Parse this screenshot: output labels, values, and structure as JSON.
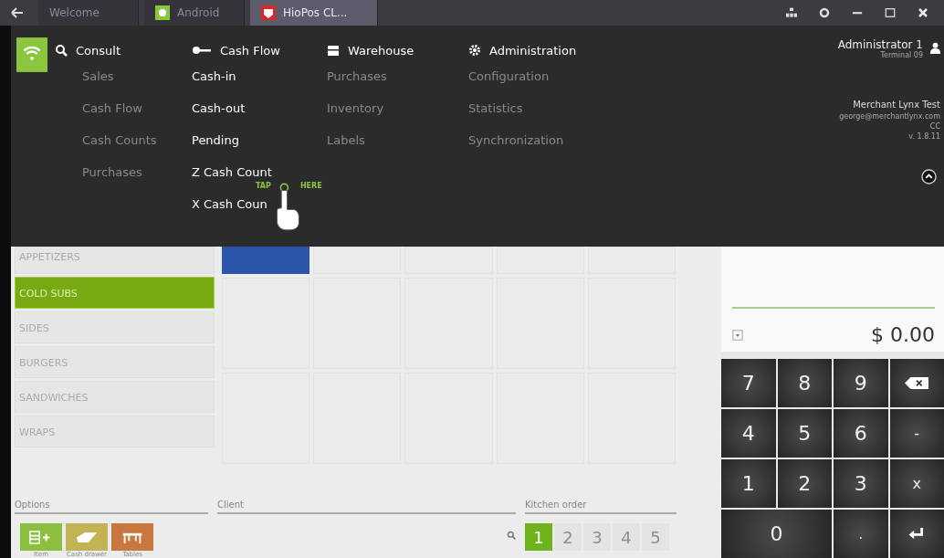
{
  "title_bar": {
    "tabs": [
      {
        "label": "Welcome",
        "selected": false
      },
      {
        "label": "Android",
        "selected": false
      },
      {
        "label": "HioPos CL...",
        "selected": true
      }
    ]
  },
  "menu": {
    "columns": [
      {
        "title": "Consult",
        "highlighted": false,
        "items": [
          "Sales",
          "Cash Flow",
          "Cash Counts",
          "Purchases"
        ]
      },
      {
        "title": "Cash Flow",
        "highlighted": true,
        "items": [
          "Cash-in",
          "Cash-out",
          "Pending",
          "Z Cash Count",
          "X Cash Coun"
        ]
      },
      {
        "title": "Warehouse",
        "highlighted": false,
        "items": [
          "Purchases",
          "Inventory",
          "Labels"
        ]
      },
      {
        "title": "Administration",
        "highlighted": false,
        "items": [
          "Configuration",
          "Statistics",
          "Synchronization"
        ]
      }
    ],
    "user": {
      "name": "Administrator 1",
      "terminal": "Terminal 09"
    },
    "merchant": {
      "name": "Merchant Lynx Test",
      "email": "george@merchantlynx.com",
      "line_3": "CC",
      "version": "v. 1.8.11"
    },
    "tap_hint": {
      "words": [
        "TAP",
        "HERE"
      ]
    }
  },
  "categories": [
    {
      "label": "APPETIZERS",
      "selected": false
    },
    {
      "label": "COLD SUBS",
      "selected": true
    },
    {
      "label": "SIDES",
      "selected": false
    },
    {
      "label": "BURGERS",
      "selected": false
    },
    {
      "label": "SANDWICHES",
      "selected": false
    },
    {
      "label": "WRAPS",
      "selected": false
    }
  ],
  "fields": {
    "options": {
      "placeholder": "Options"
    },
    "client": {
      "placeholder": "Client"
    },
    "kitchen_order": {
      "placeholder": "Kitchen order"
    }
  },
  "option_buttons": [
    {
      "label": "Item",
      "kind": "item",
      "color": "#8cbf3f"
    },
    {
      "label": "Cash drawer",
      "kind": "drawer",
      "color": "#c2b453"
    },
    {
      "label": "Tables",
      "kind": "tables",
      "color": "#c9763f"
    }
  ],
  "pages": [
    {
      "label": "1",
      "selected": true
    },
    {
      "label": "2",
      "selected": false
    },
    {
      "label": "3",
      "selected": false
    },
    {
      "label": "4",
      "selected": false
    },
    {
      "label": "5",
      "selected": false
    }
  ],
  "total": "$ 0.00",
  "keypad": [
    {
      "label": "7",
      "kind": "digit"
    },
    {
      "label": "8",
      "kind": "digit"
    },
    {
      "label": "9",
      "kind": "digit"
    },
    {
      "kind": "backspace"
    },
    {
      "label": "4",
      "kind": "digit"
    },
    {
      "label": "5",
      "kind": "digit"
    },
    {
      "label": "6",
      "kind": "digit"
    },
    {
      "label": "-",
      "kind": "op"
    },
    {
      "label": "1",
      "kind": "digit"
    },
    {
      "label": "2",
      "kind": "digit"
    },
    {
      "label": "3",
      "kind": "digit"
    },
    {
      "label": "x",
      "kind": "op"
    },
    {
      "label": "0",
      "kind": "wide"
    },
    {
      "label": ".",
      "kind": "op"
    },
    {
      "kind": "enter"
    }
  ]
}
